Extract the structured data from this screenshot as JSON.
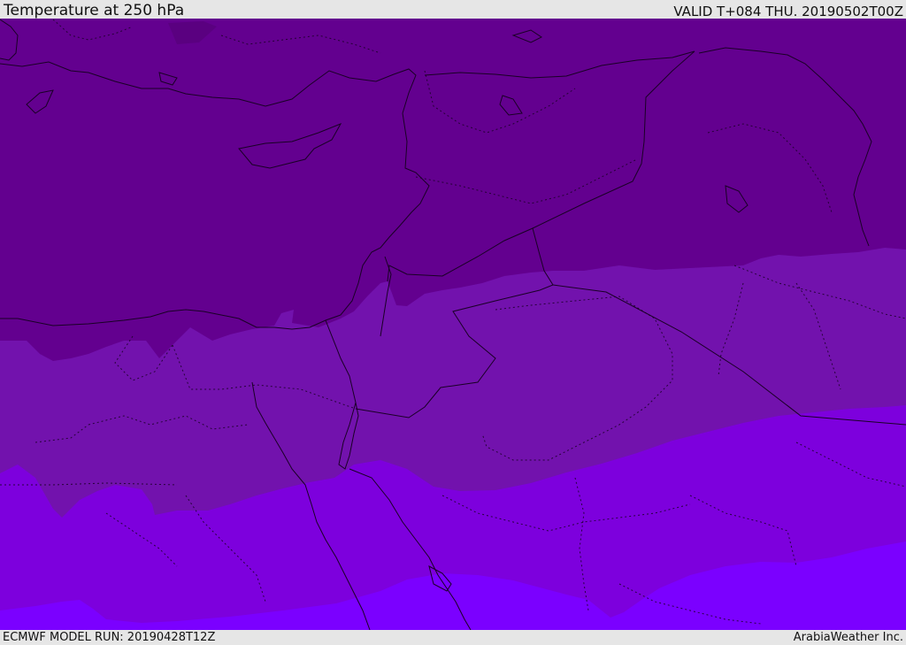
{
  "header": {
    "title": "Temperature at 250 hPa",
    "valid": "VALID T+084 THU. 20190502T00Z"
  },
  "footer": {
    "model_run": "ECMWF MODEL RUN: 20190428T12Z",
    "credit": "ArabiaWeather Inc."
  },
  "map": {
    "colors": {
      "band_coldest": "#63008f",
      "band_cold": "#7212ad",
      "band_mid": "#7d00dd",
      "band_warm": "#7b00ff",
      "border": "#1a0026"
    }
  }
}
